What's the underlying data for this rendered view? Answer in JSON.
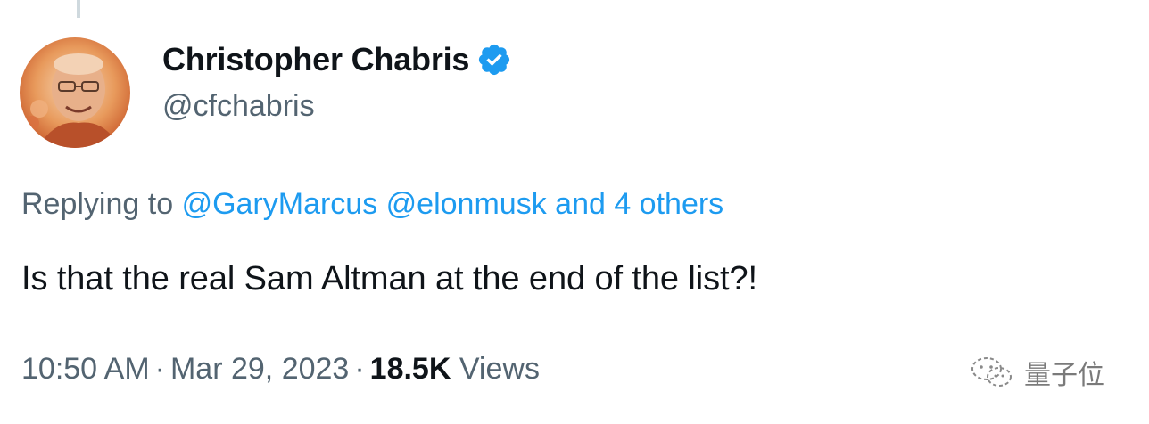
{
  "author": {
    "display_name": "Christopher Chabris",
    "handle": "@cfchabris",
    "verified": true,
    "avatar_icon": "profile-photo"
  },
  "reply": {
    "prefix": "Replying to",
    "mentions": [
      "@GaryMarcus",
      "@elonmusk"
    ],
    "others": "and 4 others"
  },
  "tweet": {
    "text": "Is that the real Sam Altman at the end of the list?!"
  },
  "meta": {
    "time": "10:50 AM",
    "separator": "·",
    "date": "Mar 29, 2023",
    "views_count": "18.5K",
    "views_label": "Views"
  },
  "watermark": {
    "text": "量子位",
    "icon": "wechat-icon"
  },
  "colors": {
    "link": "#1d9bf0",
    "secondary_text": "#536471",
    "primary_text": "#0f1419",
    "verified_badge": "#1d9bf0"
  }
}
